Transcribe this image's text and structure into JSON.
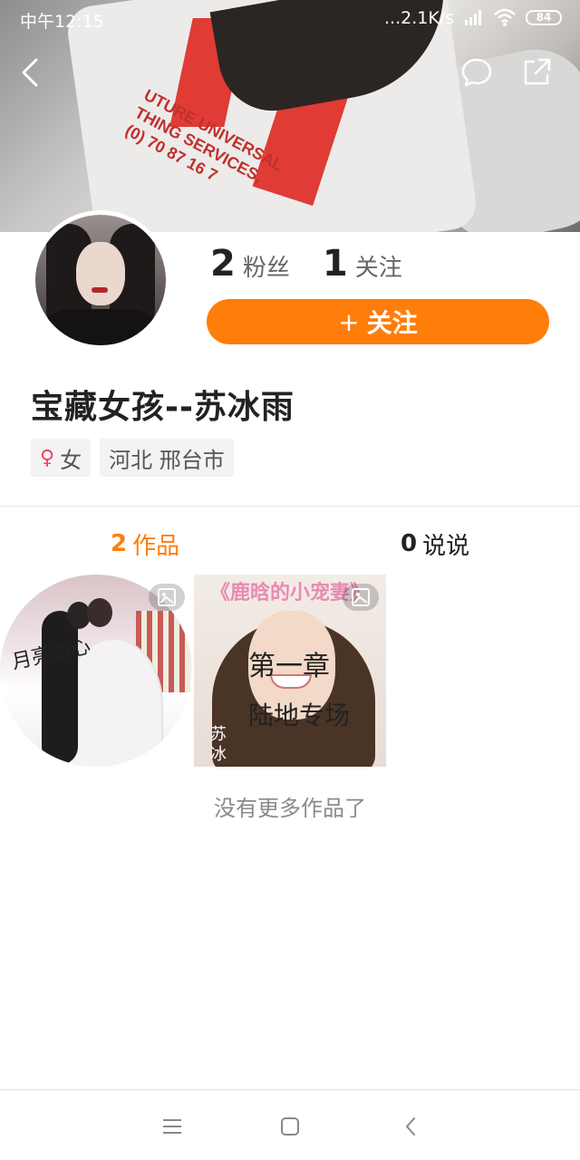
{
  "status_bar": {
    "time": "中午12:15",
    "network": "...2.1K/s",
    "battery": "84"
  },
  "cover": {
    "print_text": "UTURE UNIVERSAL\nTHING SERVICES,\n(0) 70 87 16 7"
  },
  "profile": {
    "fans_count": "2",
    "fans_label": "粉丝",
    "following_count": "1",
    "following_label": "关注",
    "follow_button_plus": "+",
    "follow_button_label": "关注",
    "name": "宝藏女孩--苏冰雨",
    "gender_icon": "♀",
    "gender": "女",
    "location": "河北 邢台市"
  },
  "tabs": {
    "works_count": "2",
    "works_label": "作品",
    "posts_count": "0",
    "posts_label": "说说"
  },
  "works": [
    {
      "caption": "月亮如心"
    },
    {
      "title": "《鹿晗的小宠妻》",
      "chapter": "第一章",
      "subtitle": "陆地专场",
      "side_text": "苏冰"
    }
  ],
  "footer": {
    "no_more": "没有更多作品了"
  },
  "colors": {
    "accent": "#ff7d0a",
    "gender_pink": "#e8446a"
  }
}
